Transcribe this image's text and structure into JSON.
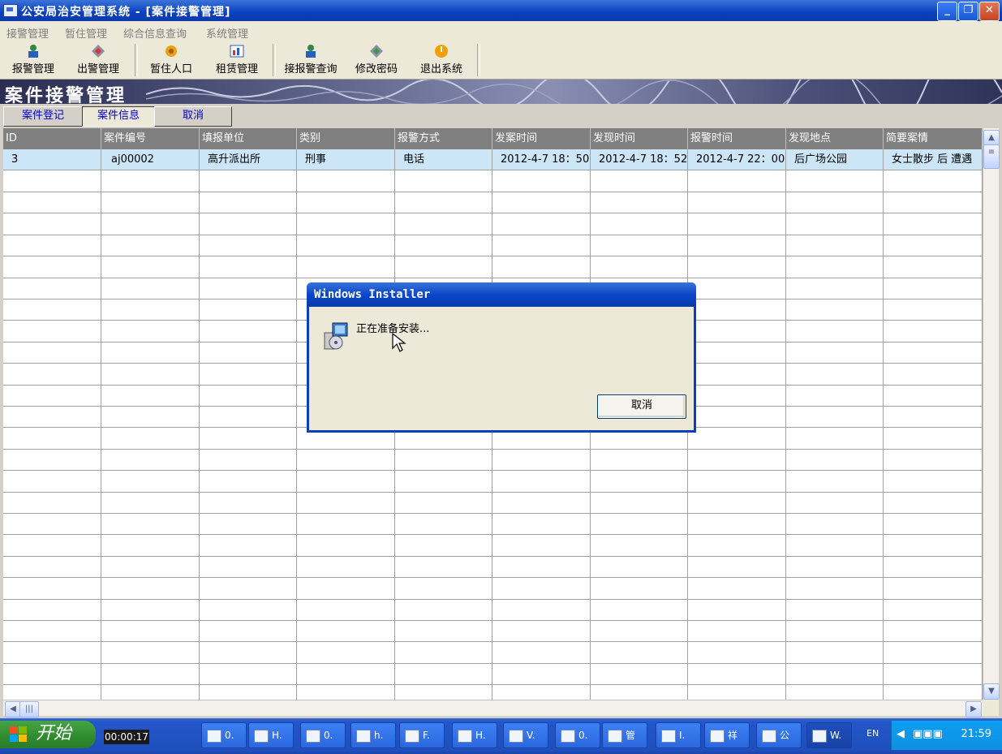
{
  "window": {
    "title": "公安局治安管理系统 - [案件接警管理]"
  },
  "menu": [
    "接警管理",
    "暂住管理",
    "综合信息查询",
    "系统管理"
  ],
  "toolbar": [
    "报警管理",
    "出警管理",
    "暂住人口",
    "租赁管理",
    "接报警查询",
    "修改密码",
    "退出系统"
  ],
  "banner": {
    "title": "案件接警管理"
  },
  "tabs": [
    "案件登记",
    "案件信息",
    "取消"
  ],
  "grid": {
    "columns": [
      "ID",
      "案件编号",
      "填报单位",
      "类别",
      "报警方式",
      "发案时间",
      "发现时间",
      "报警时间",
      "发现地点",
      "简要案情"
    ],
    "rows": [
      [
        "3",
        "aj00002",
        "高升派出所",
        "刑事",
        "电话",
        "2012-4-7 18：50",
        "2012-4-7 18：52",
        "2012-4-7 22：00",
        "后广场公园",
        "女士散步 后 遭遇"
      ]
    ]
  },
  "dialog": {
    "title": "Windows Installer",
    "message": "正在准备安装...",
    "cancel": "取消"
  },
  "taskbar": {
    "start": "开始",
    "timer": "00:00:17",
    "tasks": [
      "0.",
      "H.",
      "0.",
      "h.",
      "F.",
      "H.",
      "V.",
      "0.",
      "管",
      "I.",
      "祥",
      "公",
      "W."
    ],
    "lang": "EN",
    "clock": "21:59"
  },
  "colors": {
    "titlebar": "#0a3fbf",
    "selected_row": "#cde6f7",
    "grid_header": "#808080",
    "start_button": "#2f8a2f"
  }
}
